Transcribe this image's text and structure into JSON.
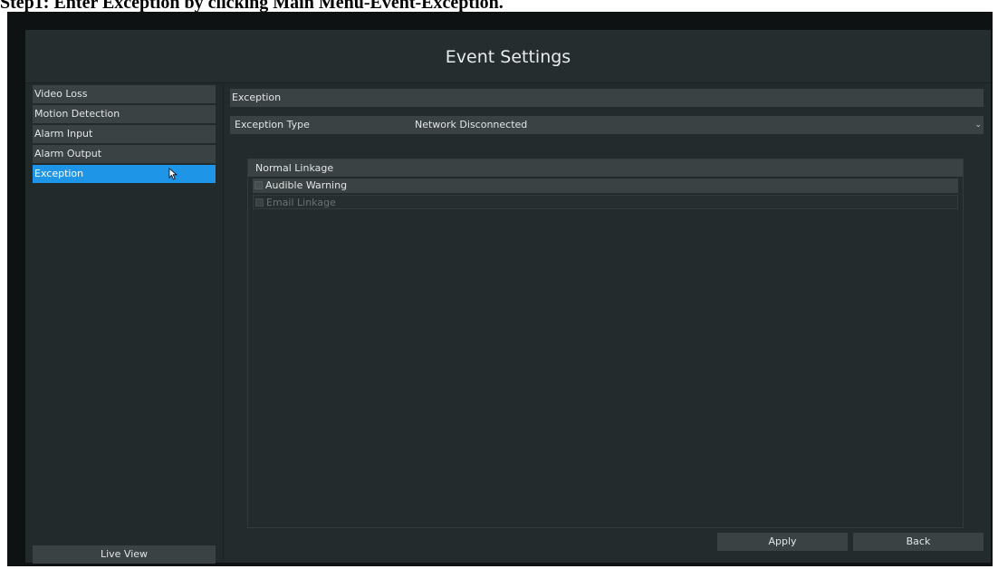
{
  "caption": "Step1: Enter Exception by clicking Main Menu-Event-Exception.",
  "window": {
    "title": "Event Settings"
  },
  "sidebar": {
    "items": [
      {
        "label": "Video Loss",
        "active": false
      },
      {
        "label": "Motion Detection",
        "active": false
      },
      {
        "label": "Alarm Input",
        "active": false
      },
      {
        "label": "Alarm Output",
        "active": false
      },
      {
        "label": "Exception",
        "active": true
      }
    ],
    "live_view_label": "Live View"
  },
  "main": {
    "section_title": "Exception",
    "exception_type": {
      "label": "Exception Type",
      "value": "Network Disconnected"
    },
    "linkage": {
      "title": "Normal Linkage",
      "options": [
        {
          "label": "Audible Warning",
          "checked": false,
          "enabled": true
        },
        {
          "label": "Email Linkage",
          "checked": false,
          "enabled": false
        }
      ]
    }
  },
  "footer": {
    "apply_label": "Apply",
    "back_label": "Back"
  },
  "colors": {
    "accent": "#1e95e6",
    "panel": "#3b4243",
    "background": "#242b2c",
    "text": "#e2e6e6",
    "disabled_text": "#6a7172"
  },
  "icons": {
    "cursor": "mouse-pointer-icon",
    "dropdown": "chevron-down-icon",
    "checkbox": "checkbox-icon"
  }
}
